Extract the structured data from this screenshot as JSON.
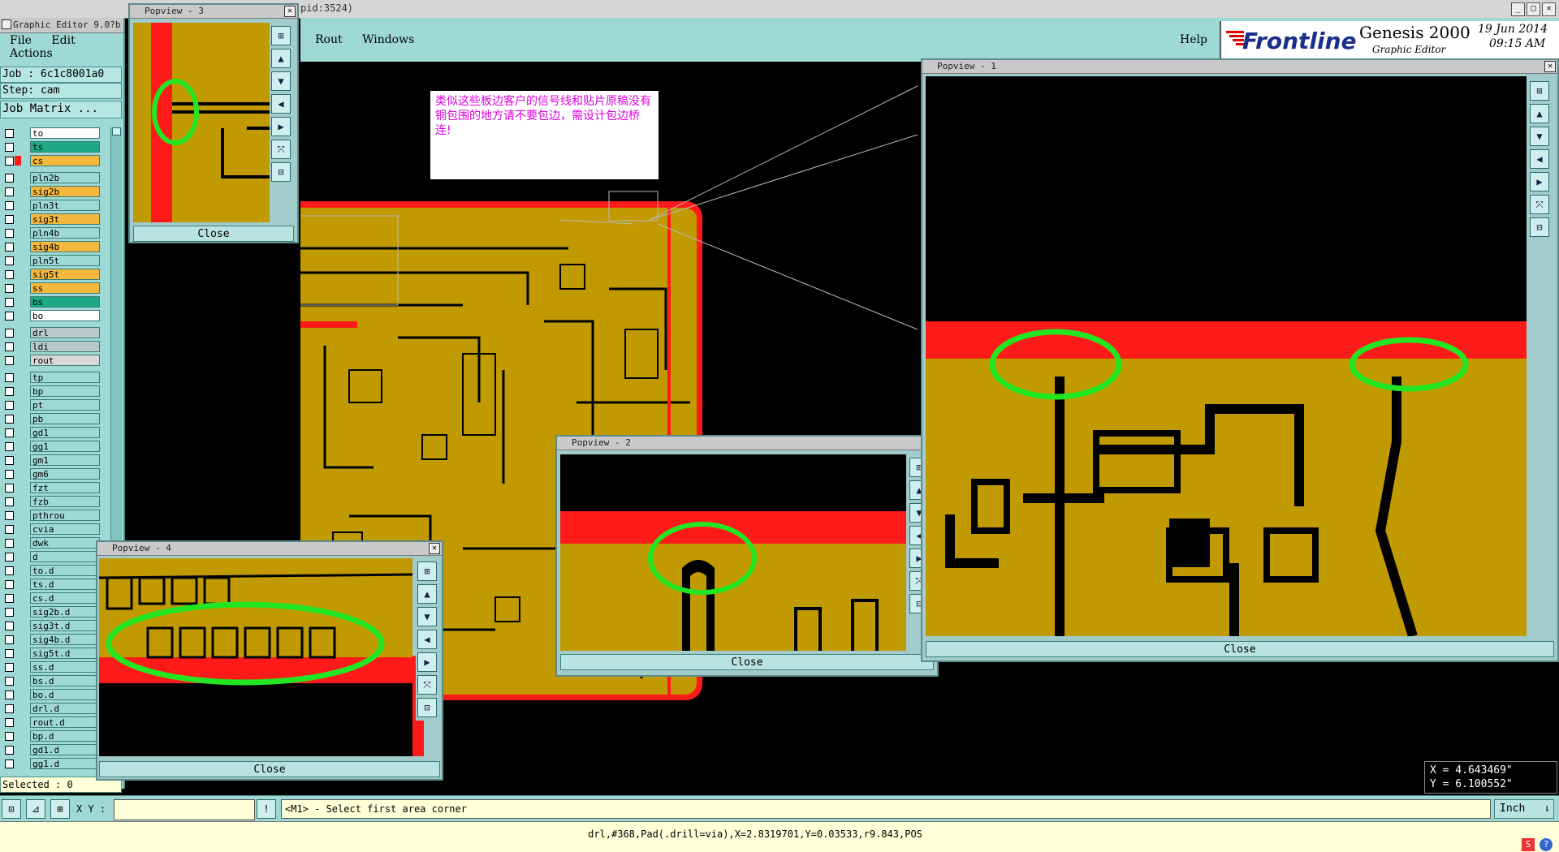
{
  "app": {
    "title": "Graphic Editor 9.0?b",
    "pid": "pid:3524)",
    "menu": [
      "File",
      "Edit",
      "Actions"
    ],
    "canvas_menu": [
      "Rout",
      "Windows"
    ],
    "help": "Help",
    "brand": "Frontline",
    "product": "Genesis 2000",
    "subtitle": "Graphic Editor",
    "date": "19 Jun 2014",
    "time": "09:15 AM"
  },
  "left": {
    "job": "Job : 6c1c8001a0",
    "step": "Step: cam",
    "matrix_btn": "Job Matrix ...",
    "selected": "Selected : 0",
    "layers": [
      {
        "name": "to",
        "color": "#ffffff"
      },
      {
        "name": "ts",
        "color": "#1fa884"
      },
      {
        "name": "cs",
        "color": "#f4b83e",
        "active": true
      },
      {
        "name": "pln2b",
        "color": "#9ed9d5"
      },
      {
        "name": "sig2b",
        "color": "#f4b83e"
      },
      {
        "name": "pln3t",
        "color": "#9ed9d5"
      },
      {
        "name": "sig3t",
        "color": "#f4b83e"
      },
      {
        "name": "pln4b",
        "color": "#9ed9d5"
      },
      {
        "name": "sig4b",
        "color": "#f4b83e"
      },
      {
        "name": "pln5t",
        "color": "#9ed9d5"
      },
      {
        "name": "sig5t",
        "color": "#f4b83e"
      },
      {
        "name": "ss",
        "color": "#f4b83e"
      },
      {
        "name": "bs",
        "color": "#1fa884"
      },
      {
        "name": "bo",
        "color": "#ffffff"
      },
      {
        "name": "drl",
        "color": "#b9c9c9"
      },
      {
        "name": "ldi",
        "color": "#b9c9c9"
      },
      {
        "name": "rout",
        "color": "#d8d8d8"
      },
      {
        "name": "tp",
        "color": "#9ed9d5"
      },
      {
        "name": "bp",
        "color": "#9ed9d5"
      },
      {
        "name": "pt",
        "color": "#9ed9d5"
      },
      {
        "name": "pb",
        "color": "#9ed9d5"
      },
      {
        "name": "gd1",
        "color": "#9ed9d5"
      },
      {
        "name": "gg1",
        "color": "#9ed9d5"
      },
      {
        "name": "gm1",
        "color": "#9ed9d5"
      },
      {
        "name": "gm6",
        "color": "#9ed9d5"
      },
      {
        "name": "fzt",
        "color": "#9ed9d5"
      },
      {
        "name": "fzb",
        "color": "#9ed9d5"
      },
      {
        "name": "pthrou",
        "color": "#9ed9d5"
      },
      {
        "name": "cvia",
        "color": "#9ed9d5"
      },
      {
        "name": "dwk",
        "color": "#9ed9d5"
      },
      {
        "name": "d",
        "color": "#9ed9d5"
      },
      {
        "name": "to.d",
        "color": "#9ed9d5"
      },
      {
        "name": "ts.d",
        "color": "#9ed9d5"
      },
      {
        "name": "cs.d",
        "color": "#9ed9d5"
      },
      {
        "name": "sig2b.d",
        "color": "#9ed9d5"
      },
      {
        "name": "sig3t.d",
        "color": "#9ed9d5"
      },
      {
        "name": "sig4b.d",
        "color": "#9ed9d5"
      },
      {
        "name": "sig5t.d",
        "color": "#9ed9d5"
      },
      {
        "name": "ss.d",
        "color": "#9ed9d5"
      },
      {
        "name": "bs.d",
        "color": "#9ed9d5"
      },
      {
        "name": "bo.d",
        "color": "#9ed9d5"
      },
      {
        "name": "drl.d",
        "color": "#9ed9d5"
      },
      {
        "name": "rout.d",
        "color": "#9ed9d5"
      },
      {
        "name": "bp.d",
        "color": "#9ed9d5"
      },
      {
        "name": "gd1.d",
        "color": "#9ed9d5"
      },
      {
        "name": "gg1.d",
        "color": "#9ed9d5"
      }
    ]
  },
  "note": "类似这些板边客户的信号线和贴片原稿没有铜包围的地方请不要包边，需设计包边桥连!",
  "popups": {
    "p1": {
      "title": "Popview - 1",
      "close": "Close"
    },
    "p2": {
      "title": "Popview - 2",
      "close": "Close"
    },
    "p3": {
      "title": "Popview - 3",
      "close": "Close"
    },
    "p4": {
      "title": "Popview - 4",
      "close": "Close"
    }
  },
  "coords": {
    "x": "X = 4.643469\"",
    "y": "Y = 6.100552\""
  },
  "status": {
    "xy_label": "X Y :",
    "xy_value": "",
    "prompt": "<M1> - Select first area corner",
    "units": "Inch",
    "info": "drl,#368,Pad(.drill=via),X=2.8319701,Y=0.03533,r9.843,POS"
  },
  "colors": {
    "board": "#c09a00",
    "edge": "#ff1a1a",
    "highlight": "#22e622",
    "panel": "#9ed9d5"
  }
}
